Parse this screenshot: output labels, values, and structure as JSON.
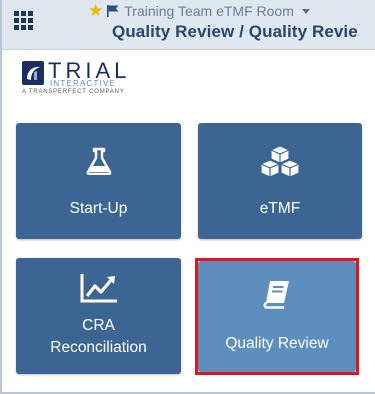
{
  "header": {
    "room_name": "Training Team eTMF Room",
    "page_title": "Quality Review / Quality Revie"
  },
  "logo": {
    "wordmark": "TRIAL",
    "subtitle": "INTERACTIVE",
    "company": "A TRANSPERFECT COMPANY"
  },
  "tiles": [
    {
      "label": "Start-Up",
      "icon": "flask-icon"
    },
    {
      "label": "eTMF",
      "icon": "cubes-icon"
    },
    {
      "label_line1": "CRA",
      "label_line2": "Reconciliation",
      "icon": "line-chart-icon"
    },
    {
      "label": "Quality Review",
      "icon": "book-icon",
      "highlighted": true
    }
  ],
  "colors": {
    "tile": "#3c6594",
    "tile_active": "#5e8ebd",
    "highlight": "#e0141c",
    "header_bg": "#dfe7f1",
    "title": "#26476c"
  }
}
